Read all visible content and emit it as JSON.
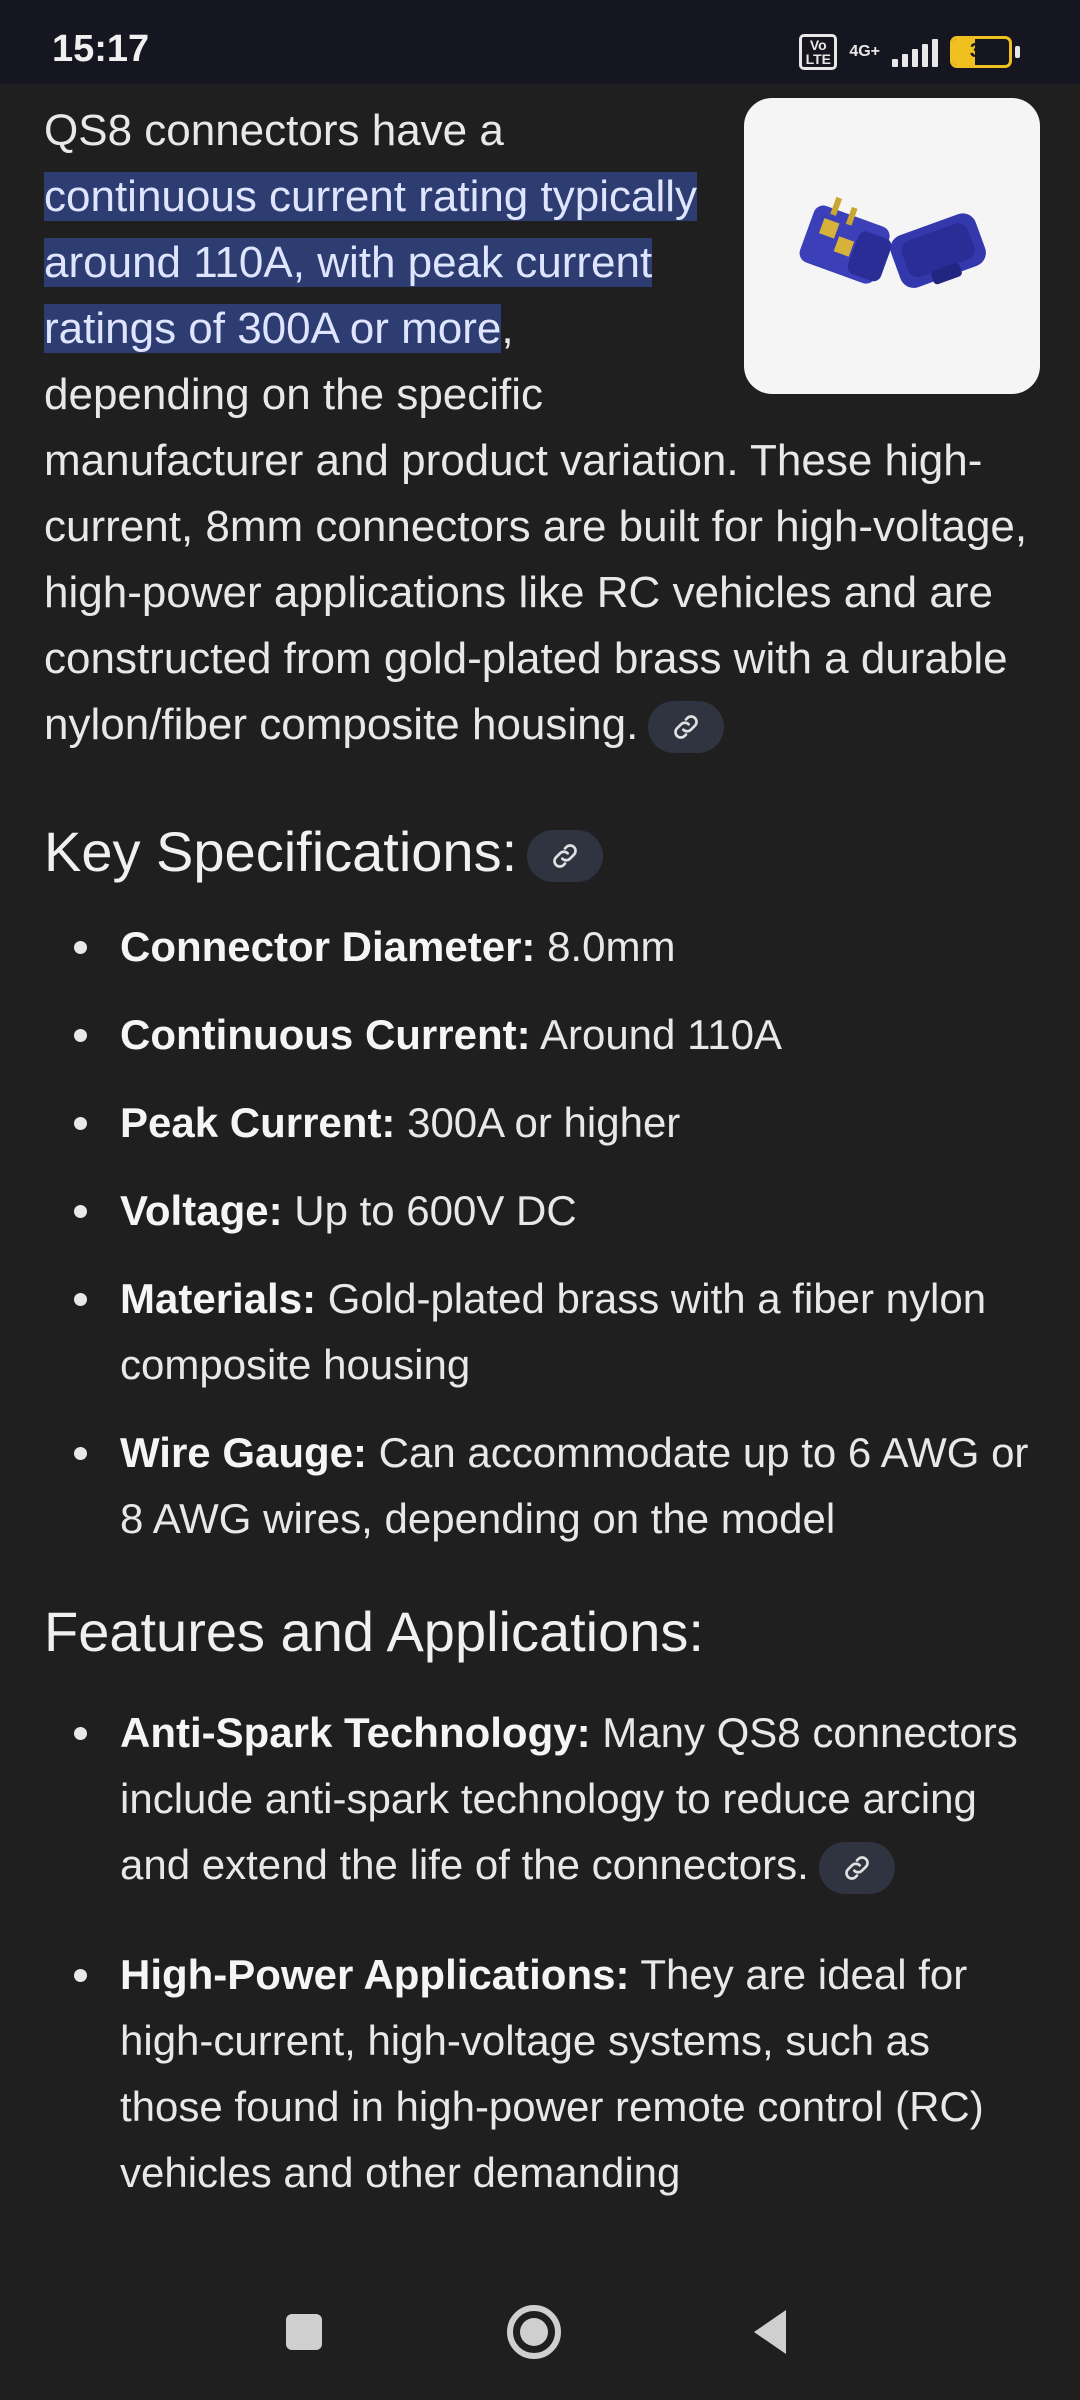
{
  "status": {
    "time": "15:17",
    "volte": "Vo LTE",
    "network": "4G+",
    "battery": "39",
    "battery_level": 39
  },
  "intro": {
    "before": "QS8 connectors have a ",
    "highlight": "continuous current rating typically around 110A, with peak current ratings of 300A or more",
    "after": ", depending on the specific manufacturer and product variation. These high-current, 8mm connectors are built for high-voltage, high-power applications like RC vehicles and are constructed from gold-plated brass with a durable nylon/fiber composite housing."
  },
  "specs": {
    "heading": "Key Specifications:",
    "items": [
      {
        "label": "Connector Diameter:",
        "text": " 8.0mm"
      },
      {
        "label": "Continuous Current:",
        "text": " Around 110A"
      },
      {
        "label": "Peak Current:",
        "text": " 300A or higher"
      },
      {
        "label": "Voltage:",
        "text": " Up to 600V DC"
      },
      {
        "label": "Materials:",
        "text": " Gold-plated brass with a fiber nylon composite housing"
      },
      {
        "label": "Wire Gauge:",
        "text": " Can accommodate up to 6 AWG or 8 AWG wires, depending on the model"
      }
    ]
  },
  "features": {
    "heading": "Features and Applications:",
    "items": [
      {
        "label": "Anti-Spark Technology:",
        "text": " Many QS8 connectors include anti-spark technology to reduce arcing and extend the life of the connectors."
      },
      {
        "label": "High-Power Applications:",
        "text": " They are ideal for high-current, high-voltage systems, such as those found in high-power remote control (RC) vehicles and other demanding"
      }
    ]
  },
  "colors": {
    "background": "#1f1f1f",
    "highlight": "#2e3d71",
    "chip": "#2f3440",
    "battery": "#f0c020"
  }
}
